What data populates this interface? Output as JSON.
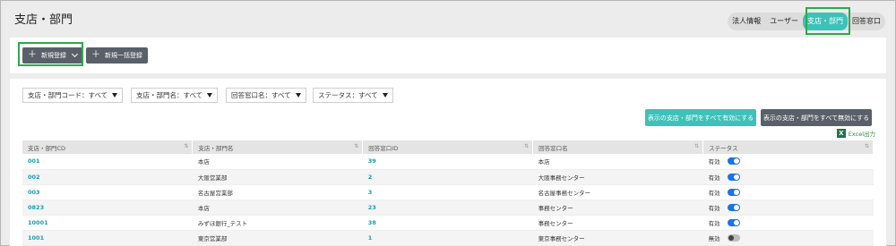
{
  "page_title": "支店・部門",
  "nav_tabs": [
    {
      "label": "法人情報"
    },
    {
      "label": "ユーザー"
    },
    {
      "label": "支店・部門"
    },
    {
      "label": "回答窓口"
    }
  ],
  "toolbar": {
    "new_label": "新規登録",
    "bulk_label": "新規一括登録"
  },
  "filters": [
    {
      "label": "支店・部門コード：すべて"
    },
    {
      "label": "支店・部門名：すべて"
    },
    {
      "label": "回答窓口名：すべて"
    },
    {
      "label": "ステータス：すべて"
    }
  ],
  "actions": {
    "enable_all": "表示の支店・部門をすべて有効にする",
    "disable_all": "表示の支店・部門をすべて無効にする",
    "excel": "Excel出力"
  },
  "table": {
    "columns": [
      "支店・部門CD",
      "支店・部門名",
      "回答窓口ID",
      "回答窓口名",
      "ステータス"
    ],
    "rows": [
      {
        "code": "001",
        "name": "本店",
        "window_id": "39",
        "window_name": "本店",
        "status": "有効",
        "on": true
      },
      {
        "code": "002",
        "name": "大阪営業部",
        "window_id": "2",
        "window_name": "大阪事務センター",
        "status": "有効",
        "on": true
      },
      {
        "code": "003",
        "name": "名古屋営業部",
        "window_id": "3",
        "window_name": "名古屋事務センター",
        "status": "有効",
        "on": true
      },
      {
        "code": "0823",
        "name": "本店",
        "window_id": "23",
        "window_name": "事務センター",
        "status": "有効",
        "on": true
      },
      {
        "code": "10001",
        "name": "みずほ銀行_テスト",
        "window_id": "38",
        "window_name": "事務センター",
        "status": "有効",
        "on": true
      },
      {
        "code": "1001",
        "name": "東京営業部",
        "window_id": "1",
        "window_name": "東京事務センター",
        "status": "無効",
        "on": false
      }
    ]
  }
}
